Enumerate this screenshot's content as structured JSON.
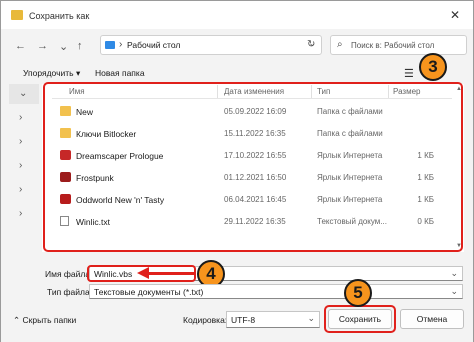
{
  "window": {
    "title": "Сохранить как",
    "close_glyph": "✕"
  },
  "nav": {
    "back": "←",
    "forward": "→",
    "up": "↑",
    "refresh": "↻",
    "separator": "›"
  },
  "address": {
    "path": "Рабочий стол",
    "chevron": "⌄"
  },
  "search": {
    "placeholder": "Поиск в: Рабочий стол",
    "icon": "search-icon"
  },
  "toolbar": {
    "organize_label": "Упорядочить ▾",
    "new_folder_label": "Новая папка",
    "view_glyph": "☰"
  },
  "columns": {
    "name": "Имя",
    "date": "Дата изменения",
    "type": "Тип",
    "size": "Размер"
  },
  "files": [
    {
      "name": "New",
      "date": "05.09.2022 16:09",
      "type": "Папка с файлами",
      "size": "",
      "icon": "folder-icon"
    },
    {
      "name": "Ключи Bitlocker",
      "date": "15.11.2022 16:35",
      "type": "Папка с файлами",
      "size": "",
      "icon": "folder-icon"
    },
    {
      "name": "Dreamscaper Prologue",
      "date": "17.10.2022 16:55",
      "type": "Ярлык Интернета",
      "size": "1 КБ",
      "icon": "internet-shortcut-icon"
    },
    {
      "name": "Frostpunk",
      "date": "01.12.2021 16:50",
      "type": "Ярлык Интернета",
      "size": "1 КБ",
      "icon": "internet-shortcut-icon"
    },
    {
      "name": "Oddworld New 'n' Tasty",
      "date": "06.04.2021 16:45",
      "type": "Ярлык Интернета",
      "size": "1 КБ",
      "icon": "internet-shortcut-icon"
    },
    {
      "name": "Winlic.txt",
      "date": "29.11.2022 16:35",
      "type": "Текстовый докум...",
      "size": "0 КБ",
      "icon": "text-file-icon"
    }
  ],
  "form": {
    "filename_label": "Имя файла:",
    "filename_value": "Winlic.vbs",
    "filetype_label": "Тип файла:",
    "filetype_value": "Текстовые документы (*.txt)",
    "encoding_label": "Кодировка:",
    "encoding_value": "UTF-8",
    "chevron": "⌄"
  },
  "buttons": {
    "hide_folders": "⌃ Скрыть папки",
    "save": "Сохранить",
    "cancel": "Отмена"
  },
  "annotations": {
    "step3": "3",
    "step4": "4",
    "step5": "5"
  },
  "colors": {
    "highlight": "#e0201b",
    "badge": "#f7941d"
  }
}
